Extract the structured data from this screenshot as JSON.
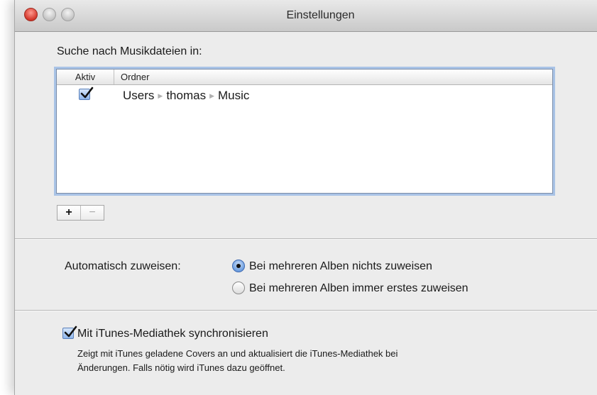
{
  "window": {
    "title": "Einstellungen"
  },
  "folders": {
    "section_label": "Suche nach Musikdateien in:",
    "columns": [
      "Aktiv",
      "Ordner"
    ],
    "rows": [
      {
        "active": true,
        "path": [
          "Users",
          "thomas",
          "Music"
        ]
      }
    ],
    "add_label": "+",
    "remove_label": "−"
  },
  "assign": {
    "label": "Automatisch zuweisen:",
    "options": [
      {
        "label": "Bei mehreren Alben nichts zuweisen",
        "selected": true
      },
      {
        "label": "Bei mehreren Alben immer erstes zuweisen",
        "selected": false
      }
    ]
  },
  "sync": {
    "label": "Mit iTunes-Mediathek synchronisieren",
    "checked": true,
    "description_line1": "Zeigt mit iTunes geladene Covers an und aktualisiert die iTunes-Mediathek bei",
    "description_line2": "Änderungen. Falls nötig wird iTunes dazu geöffnet."
  },
  "colors": {
    "window_bg": "#ececec",
    "focus_ring": "#a9c3e6",
    "close_button": "#d3362a",
    "checkbox_blue": "#8fb6ec"
  }
}
